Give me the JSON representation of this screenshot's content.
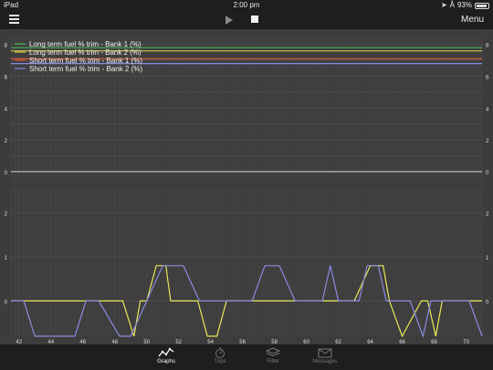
{
  "status": {
    "device": "iPad",
    "wifi_icon": "wifi-icon",
    "time": "2:00 pm",
    "battery": "93%",
    "battery_level": 0.93
  },
  "toolbar": {
    "menu_label": "Menu"
  },
  "legend": [
    {
      "label": "Long term fuel % trim - Bank 1 (%)",
      "color": "#4caf50"
    },
    {
      "label": "Long term fuel % trim - Bank 2 (%)",
      "color": "#c8c84a"
    },
    {
      "label": "Short term fuel % trim - Bank 1 (%)",
      "color": "#e05a3a"
    },
    {
      "label": "Short term fuel % trim - Bank 2 (%)",
      "color": "#8a8ae0"
    }
  ],
  "chart_data": [
    {
      "type": "line",
      "xlim": [
        41.5,
        71
      ],
      "ylim": [
        -0.7,
        8.5
      ],
      "yticks_left": [
        "8",
        "6",
        "4",
        "2",
        "0"
      ],
      "yticks_right": [
        "8",
        "6",
        "4",
        "2",
        "0"
      ],
      "series": [
        {
          "name": "Long term fuel % trim - Bank 1 (%)",
          "color": "#4caf50",
          "x": [
            41.5,
            71
          ],
          "y": [
            7.8,
            7.8
          ]
        },
        {
          "name": "Long term fuel % trim - Bank 2 (%)",
          "color": "#c8c84a",
          "x": [
            41.5,
            71
          ],
          "y": [
            7.6,
            7.6
          ]
        },
        {
          "name": "Short term fuel % trim - Bank 1 (%)",
          "color": "#e05a3a",
          "x": [
            41.5,
            71
          ],
          "y": [
            7.1,
            7.1
          ]
        },
        {
          "name": "Short term fuel % trim - Bank 2 (%)",
          "color": "#8a8ae0",
          "x": [
            41.5,
            71
          ],
          "y": [
            6.8,
            6.8
          ]
        }
      ]
    },
    {
      "type": "line",
      "xlim": [
        41.5,
        71
      ],
      "ylim": [
        -0.8,
        2.6
      ],
      "xticks": [
        "42",
        "44",
        "46",
        "48",
        "50",
        "52",
        "54",
        "56",
        "58",
        "60",
        "62",
        "64",
        "66",
        "68",
        "70"
      ],
      "yticks_left": [
        "2",
        "1",
        "0"
      ],
      "yticks_right": [
        "2",
        "1",
        "0"
      ],
      "series": [
        {
          "name": "Short term fuel % trim - Bank 1 (%)",
          "color": "#e8e85a",
          "x": [
            41.5,
            48.5,
            49.2,
            49.6,
            50.0,
            50.6,
            51.2,
            51.5,
            52.3,
            53.2,
            53.8,
            54.4,
            55.0,
            57.0,
            57.8,
            59.8,
            60.2,
            61.5,
            62.0,
            62.5,
            63.0,
            64.0,
            64.8,
            65.2,
            66.0,
            67.2,
            67.6,
            68.1,
            68.5,
            71.0
          ],
          "y": [
            0,
            0,
            -1.2,
            0,
            0,
            0.8,
            0.8,
            0,
            0,
            0,
            -1.2,
            -1.2,
            0,
            0,
            0,
            0,
            0,
            0,
            0,
            0,
            0,
            0.8,
            0.8,
            0,
            -1.2,
            0,
            0,
            -1.2,
            0,
            0
          ]
        },
        {
          "name": "Short term fuel % trim - Bank 2 (%)",
          "color": "#8a8ae0",
          "x": [
            41.5,
            42.3,
            43.0,
            45.5,
            46.2,
            47.0,
            48.3,
            49.0,
            50.0,
            51.0,
            52.3,
            53.3,
            54.0,
            54.7,
            56.6,
            57.4,
            58.3,
            59.3,
            60.5,
            61.0,
            61.5,
            62.0,
            63.3,
            63.8,
            64.5,
            65.0,
            66.5,
            67.3,
            67.8,
            70.2,
            71.0
          ],
          "y": [
            0,
            0,
            -1.2,
            -1.2,
            0,
            0,
            -1.2,
            -1.2,
            0,
            0.8,
            0.8,
            0,
            0,
            0,
            0,
            0.8,
            0.8,
            0,
            0,
            0,
            0.8,
            0,
            0,
            0.8,
            0.8,
            0,
            0,
            -1.2,
            0,
            0,
            -1.2
          ]
        }
      ]
    }
  ],
  "tabs": [
    {
      "label": "Graphs",
      "icon": "graph-icon",
      "active": true
    },
    {
      "label": "Trips",
      "icon": "stopwatch-icon",
      "active": false
    },
    {
      "label": "Filter",
      "icon": "layers-icon",
      "active": false
    },
    {
      "label": "Messages",
      "icon": "envelope-icon",
      "active": false
    }
  ]
}
